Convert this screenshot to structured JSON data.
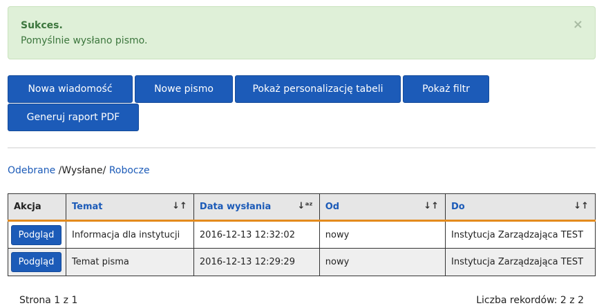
{
  "alert": {
    "title": "Sukces.",
    "message": "Pomyślnie wysłano pismo.",
    "close": "×"
  },
  "toolbar": {
    "new_message": "Nowa wiadomość",
    "new_letter": "Nowe pismo",
    "show_table_personalization": "Pokaż personalizację tabeli",
    "show_filter": "Pokaż filtr",
    "generate_pdf": "Generuj raport PDF"
  },
  "tabs": {
    "received": "Odebrane",
    "sep1": " /",
    "sent": "Wysłane",
    "sep2": "/ ",
    "drafts": "Robocze"
  },
  "table": {
    "columns": {
      "action": "Akcja",
      "subject": "Temat",
      "sent_date": "Data wysłania",
      "from": "Od",
      "to": "Do"
    },
    "sort_icons": {
      "subject": "↓↑",
      "sent_date": "↓ᵃᶻ",
      "from": "↓↑",
      "to": "↓↑"
    },
    "rows": [
      {
        "action": "Podgląd",
        "subject": "Informacja dla instytucji",
        "sent_date": "2016-12-13 12:32:02",
        "from": "nowy",
        "to": "Instytucja Zarządzająca TEST"
      },
      {
        "action": "Podgląd",
        "subject": "Temat pisma",
        "sent_date": "2016-12-13 12:29:29",
        "from": "nowy",
        "to": "Instytucja Zarządzająca TEST"
      }
    ]
  },
  "footer": {
    "page": "Strona 1 z 1",
    "records": "Liczba rekordów: 2 z 2"
  },
  "colors": {
    "primary": "#1c5bb8",
    "success_bg": "#dff0d8",
    "success_text": "#3c763d",
    "table_accent": "#e38a1c"
  }
}
